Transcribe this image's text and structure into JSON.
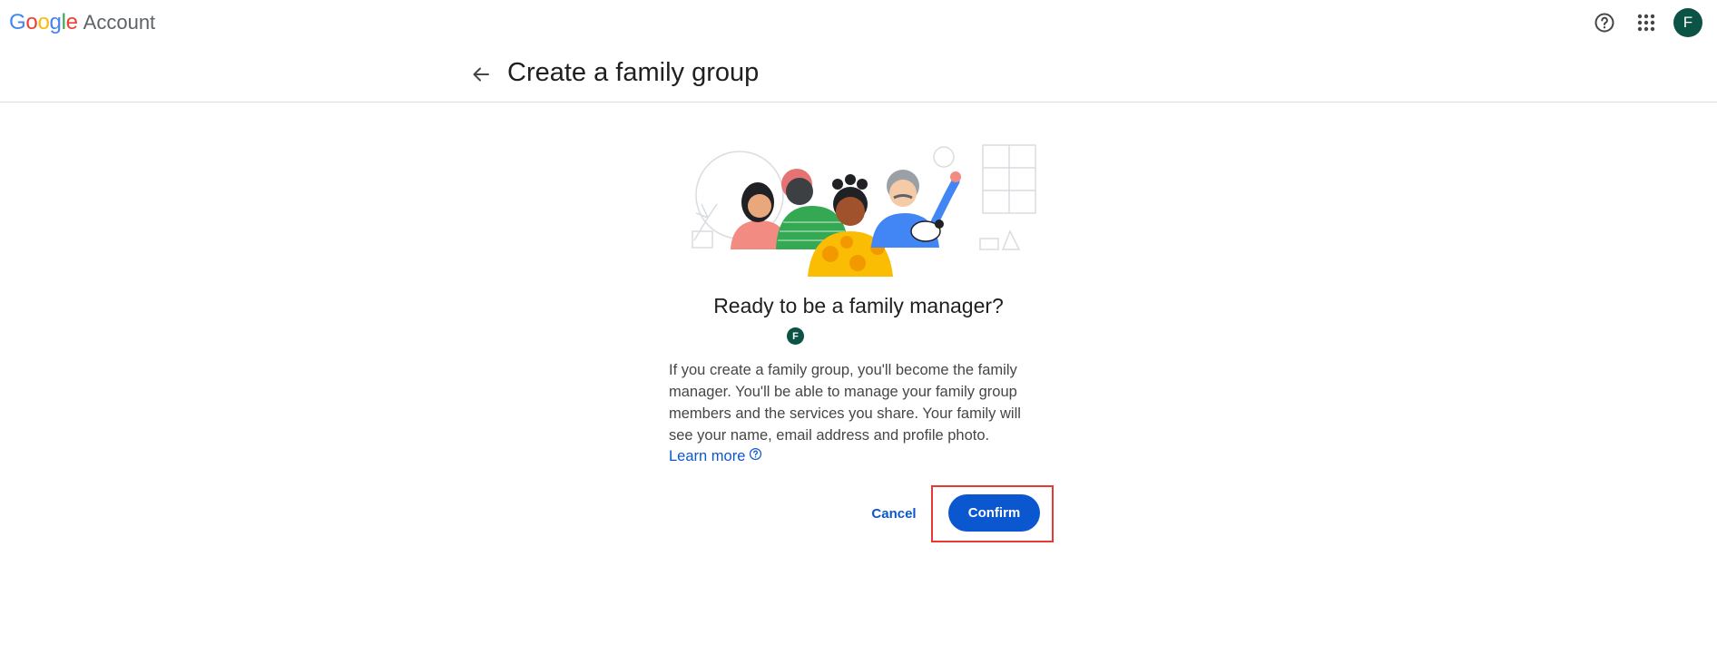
{
  "brand": {
    "google_letters": [
      {
        "ch": "G",
        "color": "#4285F4"
      },
      {
        "ch": "o",
        "color": "#EA4335"
      },
      {
        "ch": "o",
        "color": "#FBBC05"
      },
      {
        "ch": "g",
        "color": "#4285F4"
      },
      {
        "ch": "l",
        "color": "#34A853"
      },
      {
        "ch": "e",
        "color": "#EA4335"
      }
    ],
    "account_label": "Account"
  },
  "topbar": {
    "help_icon": "help-circle-icon",
    "apps_icon": "apps-grid-icon",
    "avatar_initial": "F",
    "avatar_color": "#0b5345"
  },
  "header": {
    "back_icon": "arrow-left-icon",
    "title": "Create a family group"
  },
  "content": {
    "question": "Ready to be a family manager?",
    "avatar_initial": "F",
    "description": "If you create a family group, you'll become the family manager. You'll be able to manage your family group members and the services you share. Your family will see your name, email address and profile photo.",
    "learn_more": "Learn more",
    "learn_more_icon": "help-circle-icon"
  },
  "actions": {
    "cancel_label": "Cancel",
    "confirm_label": "Confirm",
    "accent_color": "#0b57d0",
    "highlight_color": "#e53935"
  }
}
